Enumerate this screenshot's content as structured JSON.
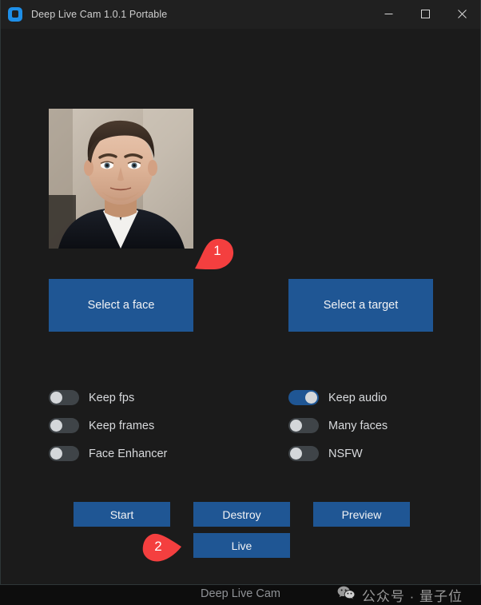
{
  "window": {
    "title": "Deep Live Cam 1.0.1 Portable",
    "icon": "app-logo-icon",
    "controls": {
      "minimize": "minimize-icon",
      "maximize": "maximize-icon",
      "close": "close-icon"
    },
    "background_color": "#1b1b1b",
    "titlebar_color": "#202020",
    "accent_color": "#1f5694"
  },
  "face_preview": {
    "alt": "selected face portrait",
    "has_image": true
  },
  "selectors": {
    "face_label": "Select a face",
    "target_label": "Select a target"
  },
  "options": {
    "left": [
      {
        "label": "Keep fps",
        "enabled": false
      },
      {
        "label": "Keep frames",
        "enabled": false
      },
      {
        "label": "Face Enhancer",
        "enabled": false
      }
    ],
    "right": [
      {
        "label": "Keep audio",
        "enabled": true
      },
      {
        "label": "Many faces",
        "enabled": false
      },
      {
        "label": "NSFW",
        "enabled": false
      }
    ]
  },
  "actions": {
    "start": "Start",
    "destroy": "Destroy",
    "preview": "Preview",
    "live": "Live"
  },
  "footer": {
    "link": "Deep Live Cam",
    "watermark_icon": "wechat-icon",
    "watermark_text": "公众号 · 量子位"
  },
  "annotations": [
    {
      "number": "1",
      "color": "#f43f3f",
      "points_to": "select-a-face-button"
    },
    {
      "number": "2",
      "color": "#f43f3f",
      "points_to": "live-button"
    }
  ]
}
